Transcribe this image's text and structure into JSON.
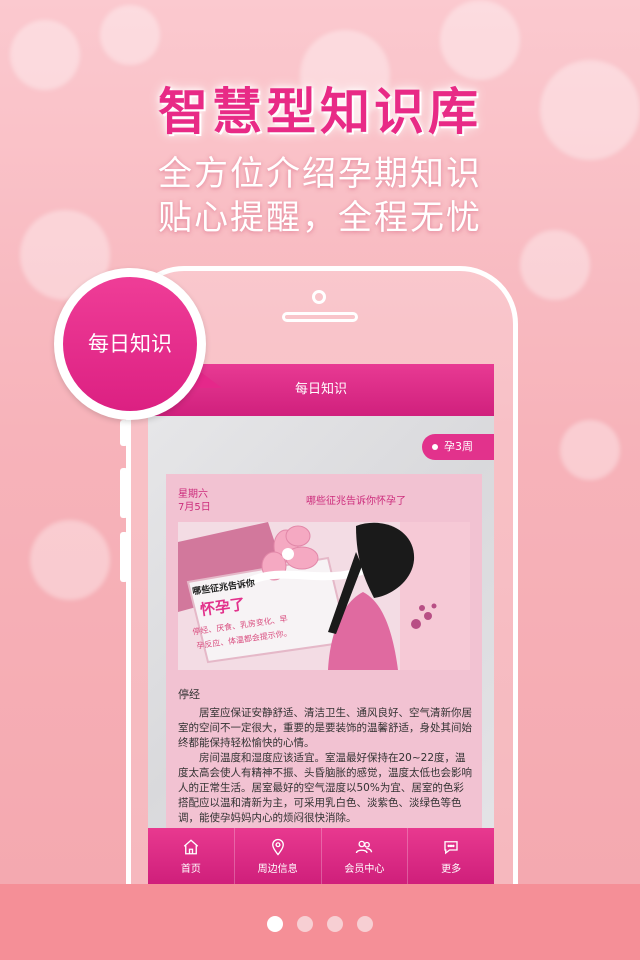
{
  "promo": {
    "headline": "智慧型知识库",
    "subline1": "全方位介绍孕期知识",
    "subline2": "贴心提醒，全程无忧"
  },
  "bubble": {
    "label": "每日知识"
  },
  "app": {
    "nav_title": "每日知识",
    "week_badge": "孕3周",
    "card": {
      "weekday": "星期六",
      "date": "7月5日",
      "title": "哪些征兆告诉你怀孕了",
      "illustration_text": {
        "line1": "哪些征兆告诉你",
        "line2": "怀孕了",
        "line3": "停经、厌食、乳房变化、早",
        "line4": "孕反应、体温都会提示你。"
      },
      "section_title": "停经",
      "paragraphs": [
        "居室应保证安静舒适、清洁卫生、通风良好、空气清新你居室的空间不一定很大，重要的是要装饰的温馨舒适，身处其间始终都能保持轻松愉快的心情。",
        "房间温度和湿度应该适宜。室温最好保持在20~22度，温度太高会使人有精神不振、头昏脑胀的感觉，温度太低也会影响人的正常生活。居室最好的空气湿度以50%为宜、居室的色彩搭配应以温和清新为主，可采用乳白色、淡紫色、淡绿色等色调，能使孕妈妈内心的烦闷很快消除。"
      ]
    },
    "tabs": [
      {
        "label": "首页",
        "icon": "home-icon"
      },
      {
        "label": "周边信息",
        "icon": "location-pin-icon"
      },
      {
        "label": "会员中心",
        "icon": "users-icon"
      },
      {
        "label": "更多",
        "icon": "chat-bubble-icon"
      }
    ]
  },
  "pagination": {
    "total": 4,
    "active": 1
  },
  "colors": {
    "brand_pink": "#e2328c",
    "headline_pink": "#e82a86",
    "background": "#f7b3ba"
  }
}
